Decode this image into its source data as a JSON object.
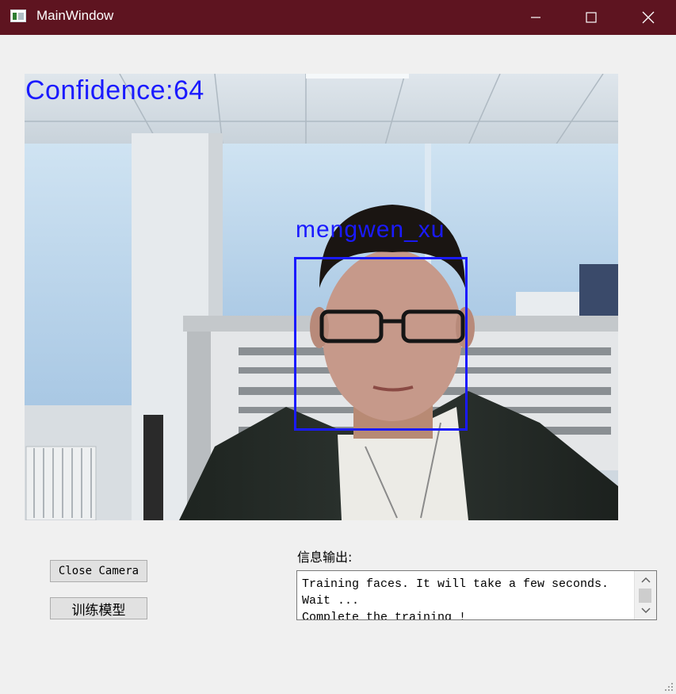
{
  "window": {
    "title": "MainWindow",
    "titlebar_color": "#5e1420",
    "controls": [
      "minimize-icon",
      "maximize-icon",
      "close-icon"
    ]
  },
  "camera": {
    "confidence_label": "Confidence:64",
    "person_label": "mengwen_xu",
    "overlay_color": "#1a1aff"
  },
  "buttons": {
    "close_camera": "Close Camera",
    "train_model": "训练模型"
  },
  "info": {
    "label": "信息输出:",
    "text": "Training faces. It will take a few seconds.\nWait ...\nComplete the training !"
  }
}
